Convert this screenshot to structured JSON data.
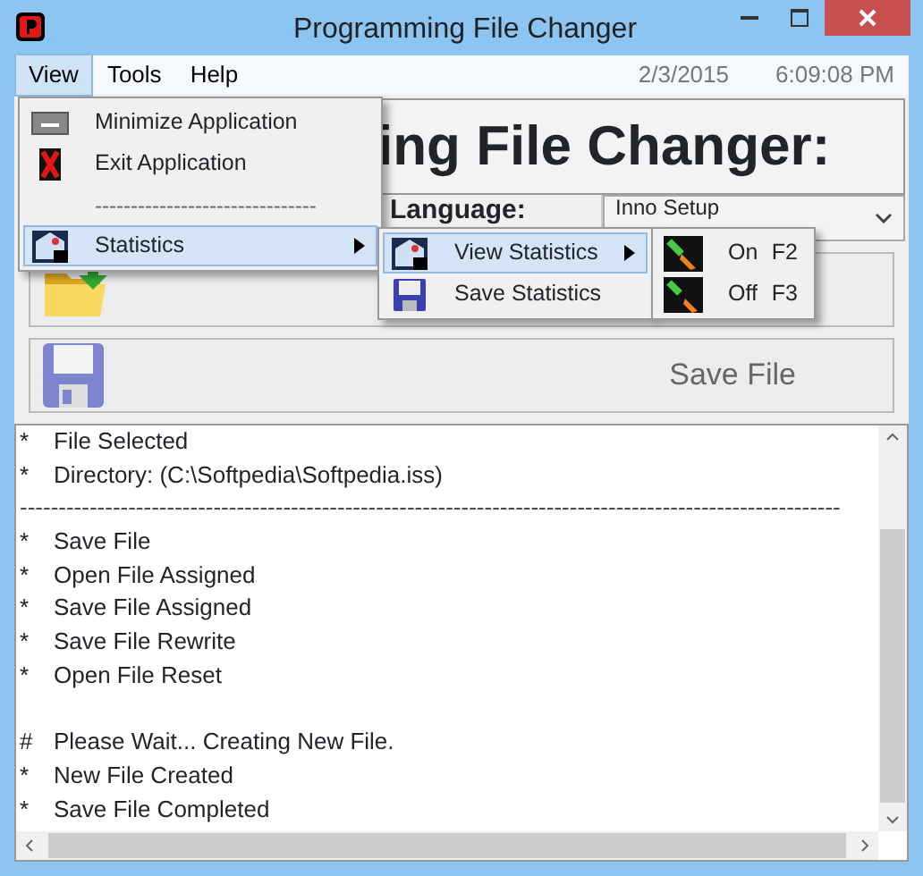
{
  "window": {
    "title": "Programming File Changer"
  },
  "menu_bar": [
    {
      "label": "View",
      "selected": true
    },
    {
      "label": "Tools",
      "selected": false
    },
    {
      "label": "Help",
      "selected": false
    }
  ],
  "date": "2/3/2015",
  "time": "6:09:08 PM",
  "view_menu": [
    {
      "kind": "item",
      "label": "Minimize Application",
      "highlighted": false
    },
    {
      "kind": "item",
      "label": "Exit Application",
      "highlighted": false
    },
    {
      "kind": "separator",
      "label": "-------------------------------"
    },
    {
      "kind": "submenu",
      "label": "Statistics",
      "highlighted": true
    }
  ],
  "statistics_menu": [
    {
      "kind": "submenu",
      "label": "View Statistics",
      "highlighted": true
    },
    {
      "kind": "item",
      "label": "Save Statistics",
      "highlighted": false
    }
  ],
  "view_statistics_menu": [
    {
      "label": "On",
      "shortcut": "F2"
    },
    {
      "label": "Off",
      "shortcut": "F3"
    }
  ],
  "heading": "ing File Changer:",
  "language_label": "Language:",
  "language_value": "Inno Setup",
  "buttons": [
    {
      "kind": "open"
    },
    {
      "kind": "save",
      "label": "Save File"
    }
  ],
  "log": [
    {
      "kind": "entry",
      "marker": "*",
      "text": "File Selected"
    },
    {
      "kind": "entry",
      "marker": "*",
      "text": "Directory:   (C:\\Softpedia\\Softpedia.iss)"
    },
    {
      "kind": "rule",
      "text": "----------------------------------------------------------------------------------------------------------"
    },
    {
      "kind": "entry",
      "marker": "*",
      "text": "Save File"
    },
    {
      "kind": "entry",
      "marker": "*",
      "text": "Open File Assigned"
    },
    {
      "kind": "entry",
      "marker": "*",
      "text": "Save File Assigned"
    },
    {
      "kind": "entry",
      "marker": "*",
      "text": "Save File Rewrite"
    },
    {
      "kind": "entry",
      "marker": "*",
      "text": "Open File Reset"
    },
    {
      "kind": "blank"
    },
    {
      "kind": "entry",
      "marker": "#",
      "text": "Please Wait... Creating New File."
    },
    {
      "kind": "entry",
      "marker": "*",
      "text": "New File Created"
    },
    {
      "kind": "entry",
      "marker": "*",
      "text": "Save File Completed"
    }
  ]
}
